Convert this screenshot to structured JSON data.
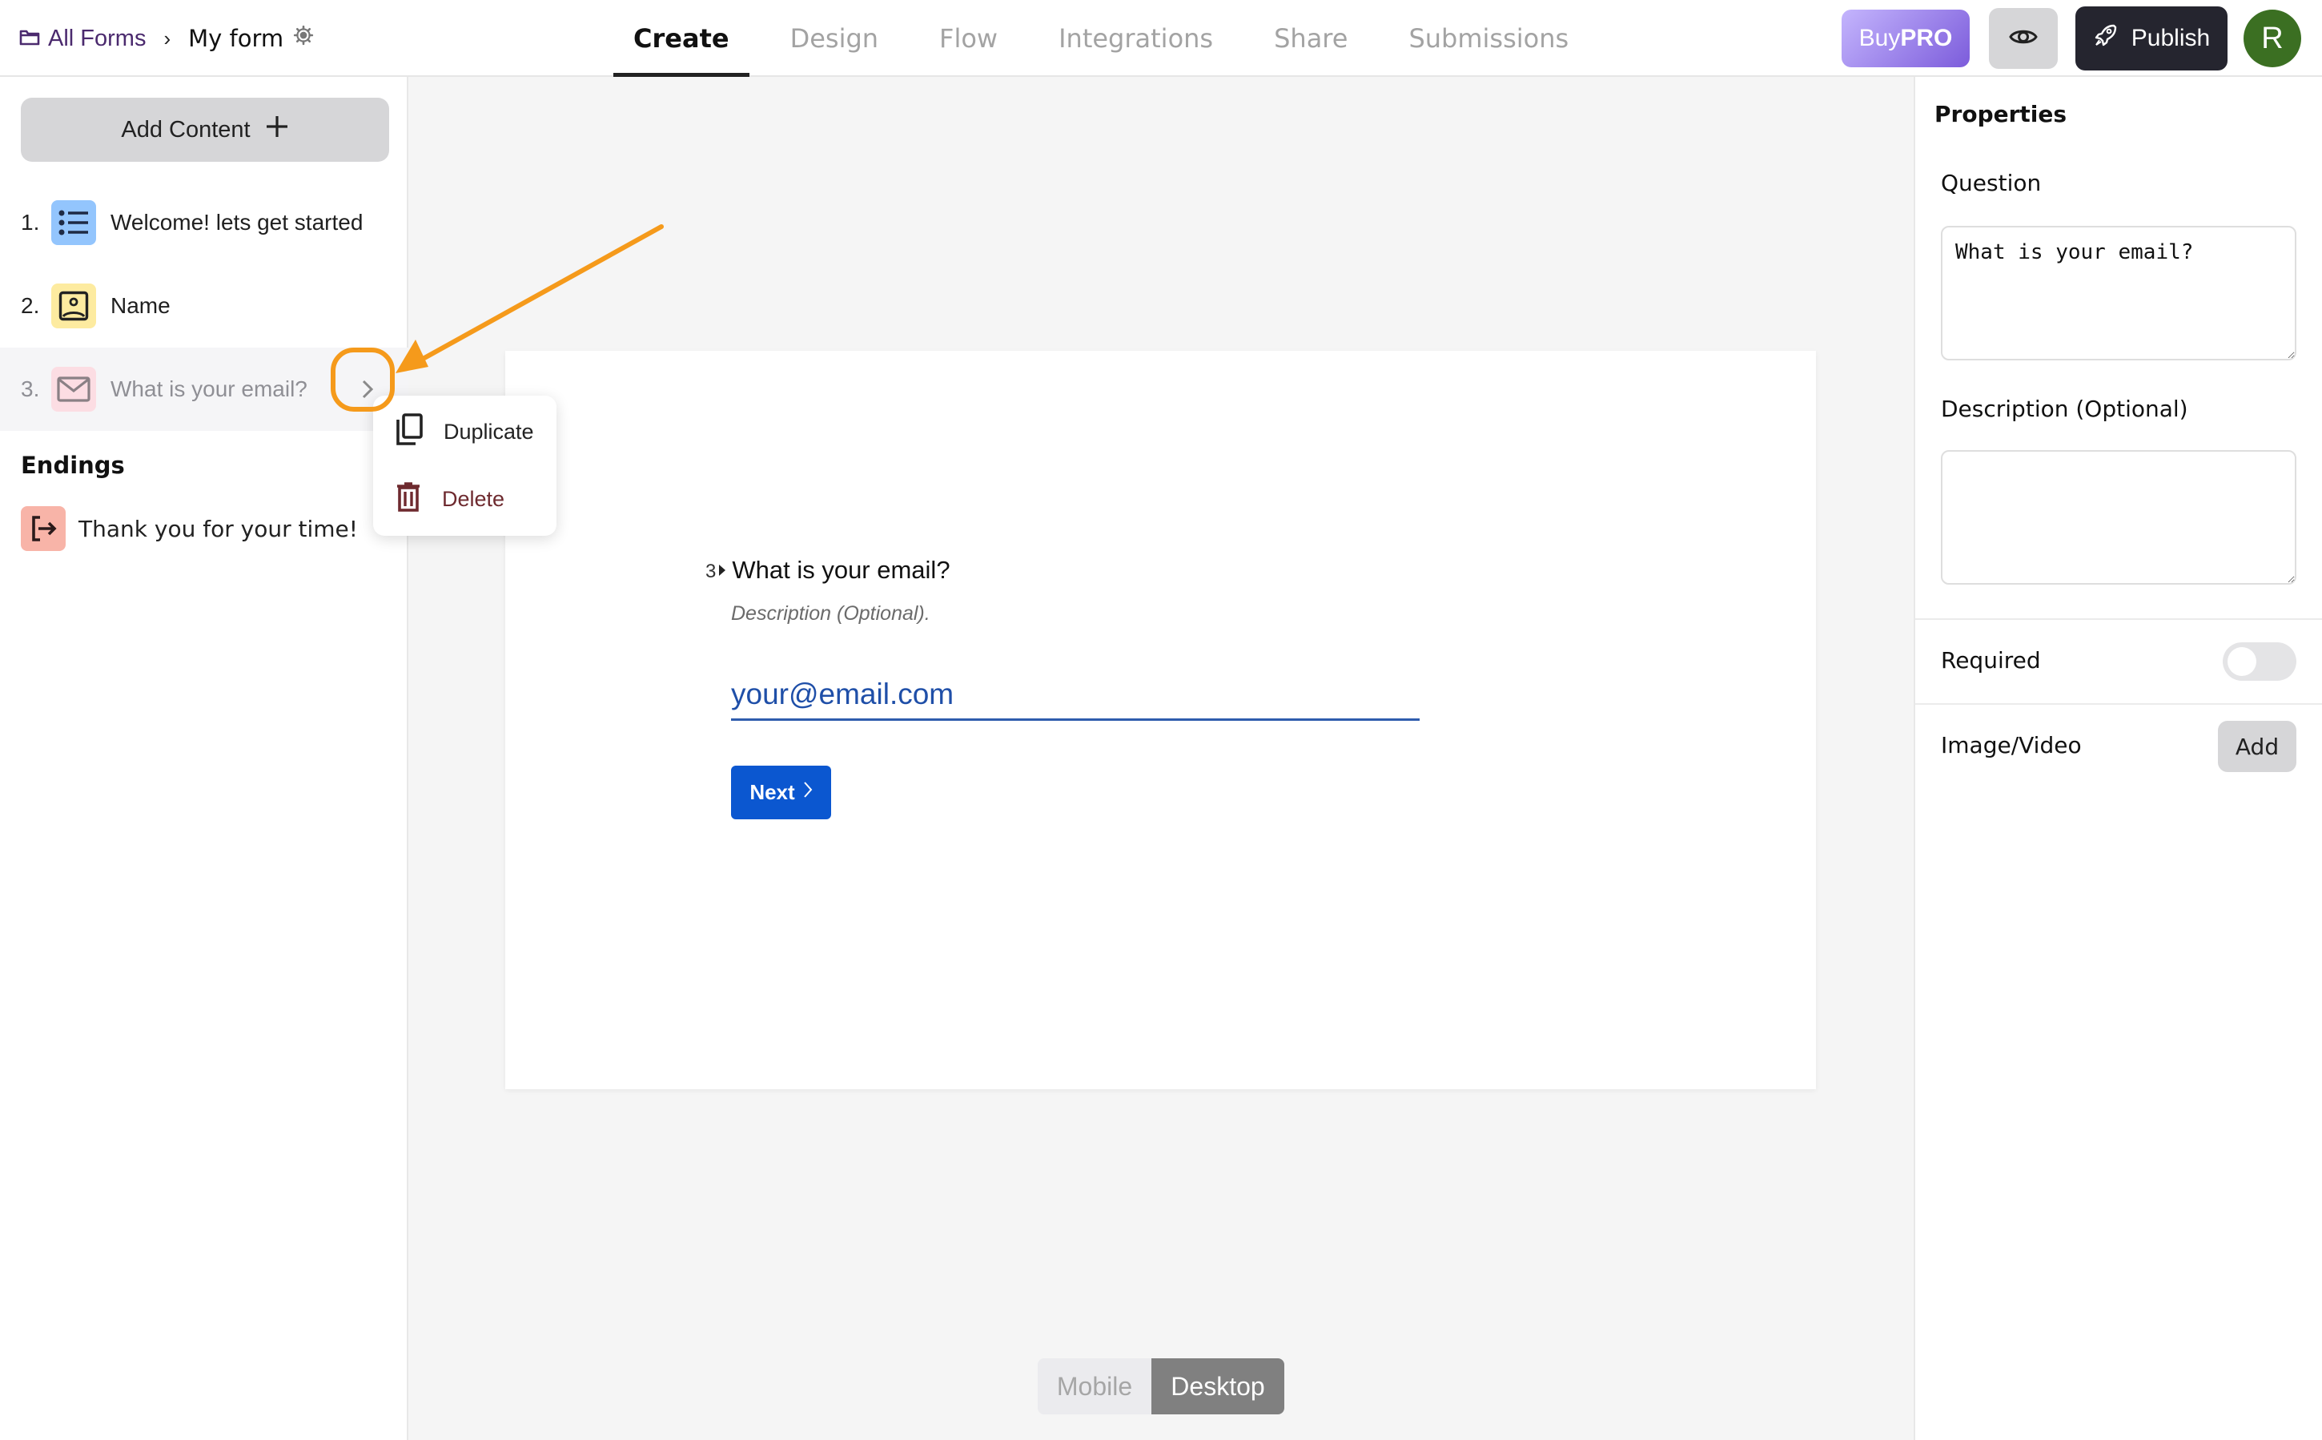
{
  "header": {
    "breadcrumb": {
      "all_forms": "All Forms",
      "separator": "›",
      "form_name": "My form"
    },
    "tabs": [
      {
        "label": "Create",
        "active": true
      },
      {
        "label": "Design",
        "active": false
      },
      {
        "label": "Flow",
        "active": false
      },
      {
        "label": "Integrations",
        "active": false
      },
      {
        "label": "Share",
        "active": false
      },
      {
        "label": "Submissions",
        "active": false
      }
    ],
    "buy_pro": {
      "prefix": "Buy",
      "bold": "PRO"
    },
    "preview_icon": "eye-icon",
    "publish_label": "Publish",
    "avatar_initial": "R"
  },
  "sidebar": {
    "add_content_label": "Add Content",
    "questions": [
      {
        "number": "1.",
        "label": "Welcome! lets get started",
        "icon": "list-icon",
        "icon_bg": "#93c5fd"
      },
      {
        "number": "2.",
        "label": "Name",
        "icon": "contact-icon",
        "icon_bg": "#fdeba0"
      },
      {
        "number": "3.",
        "label": "What is your email?",
        "icon": "mail-icon",
        "icon_bg": "#fcdde3",
        "selected": true
      }
    ],
    "endings_title": "Endings",
    "endings": [
      {
        "label": "Thank you for your time!",
        "icon": "exit-icon",
        "icon_bg": "#f8b4a8"
      }
    ]
  },
  "context_menu": {
    "items": [
      {
        "label": "Duplicate",
        "icon": "copy-icon"
      },
      {
        "label": "Delete",
        "icon": "trash-icon",
        "color": "#6e2a2f"
      }
    ]
  },
  "canvas": {
    "question_number": "3",
    "question": "What is your email?",
    "description": "Description (Optional).",
    "input_placeholder": "your@email.com",
    "next_label": "Next",
    "view_modes": {
      "mobile": "Mobile",
      "desktop": "Desktop",
      "active": "Desktop"
    }
  },
  "properties": {
    "title": "Properties",
    "question_label": "Question",
    "question_value": "What is your email?",
    "description_label": "Description (Optional)",
    "description_value": "",
    "required_label": "Required",
    "required": false,
    "media_label": "Image/Video",
    "media_add_label": "Add"
  },
  "colors": {
    "accent_orange": "#f59a1b",
    "next_button": "#0b57d0",
    "publish_button": "#25252f",
    "avatar": "#3b6f22"
  }
}
